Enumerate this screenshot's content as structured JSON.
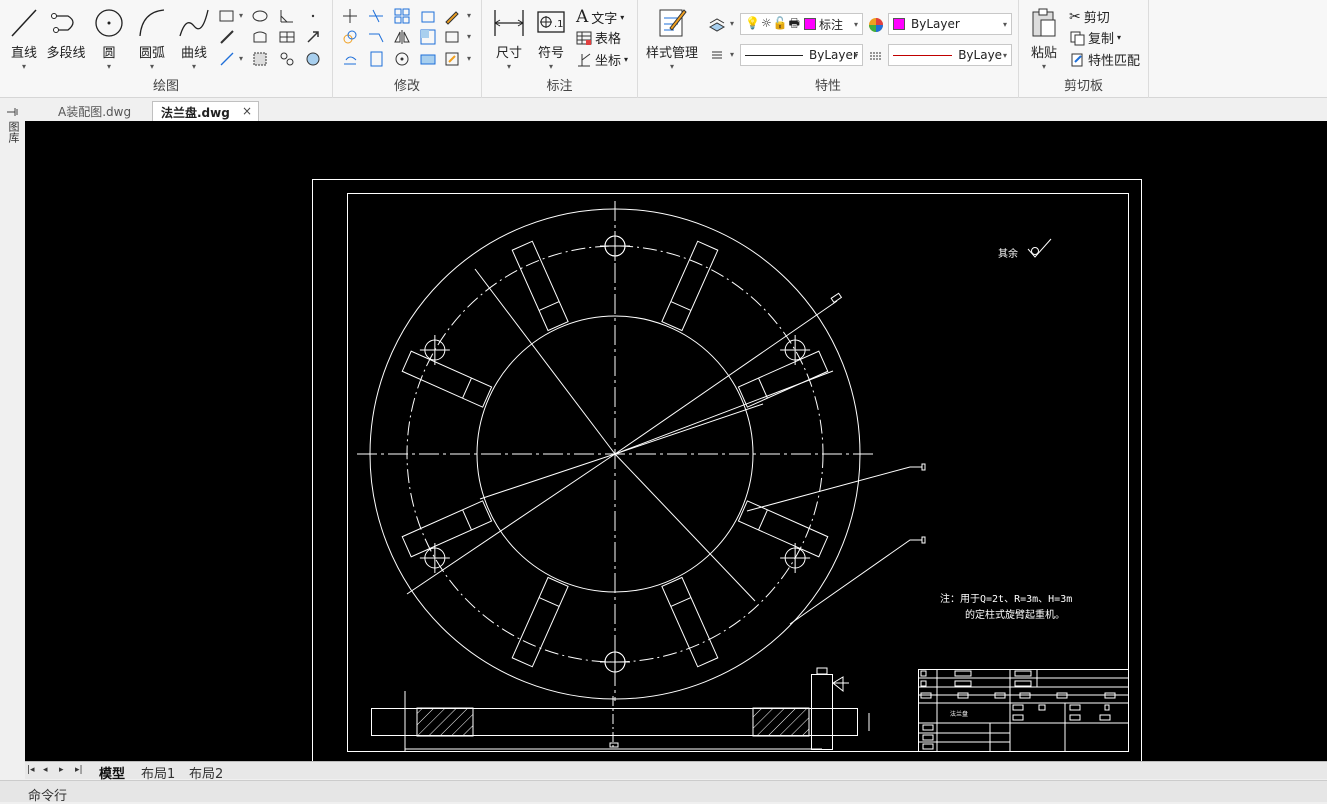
{
  "ribbon": {
    "draw": {
      "line": "直线",
      "polyline": "多段线",
      "circle": "圆",
      "arc": "圆弧",
      "curve": "曲线",
      "group": "绘图"
    },
    "modify": {
      "group": "修改"
    },
    "annotate": {
      "dimension": "尺寸",
      "symbol": "符号",
      "text": "文字",
      "table": "表格",
      "coordinate": "坐标",
      "group": "标注"
    },
    "properties": {
      "style_manager": "样式管理",
      "layer": "标注",
      "color": "ByLayer",
      "linetype": "ByLayer",
      "lineweight": "ByLayer",
      "group": "特性"
    },
    "clipboard": {
      "paste": "粘贴",
      "cut": "剪切",
      "copy": "复制",
      "match": "特性匹配",
      "group": "剪切板"
    }
  },
  "tabs": [
    {
      "label": "A装配图.dwg",
      "active": false
    },
    {
      "label": "法兰盘.dwg",
      "active": true,
      "close": "×"
    }
  ],
  "sidebar_label": "图库",
  "drawing": {
    "roughness_note": "其余",
    "note_line1": "注：用于Q=2t、R=3m、H=3m",
    "note_line2": "的定柱式旋臂起重机。",
    "title_name": "法兰盘"
  },
  "layout_tabs": [
    "模型",
    "布局1",
    "布局2"
  ],
  "layout_nav": [
    "|◂",
    "◂",
    "▸",
    "▸|"
  ],
  "command_line": "命令行",
  "colors": {
    "layer_swatch": "#ff00ff",
    "drawing_line": "#ffffff",
    "canvas_bg": "#000000",
    "lineweight_line": "#c00000"
  }
}
